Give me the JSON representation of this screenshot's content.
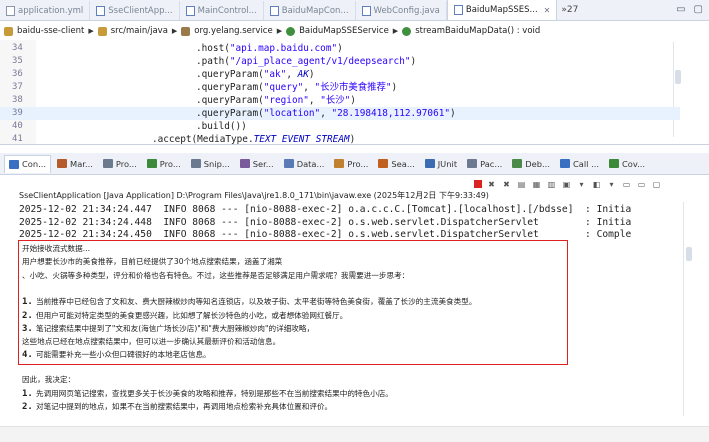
{
  "editor_tabs": [
    {
      "label": "application.yml",
      "active": false
    },
    {
      "label": "SseClientApp...",
      "active": false
    },
    {
      "label": "MainControl...",
      "active": false
    },
    {
      "label": "BaiduMapCon...",
      "active": false
    },
    {
      "label": "WebConfig.java",
      "active": false
    },
    {
      "label": "BaiduMapSSES...",
      "active": true
    }
  ],
  "tab_overflow": "»27",
  "breadcrumb": [
    "baidu-sse-client",
    "src/main/java",
    "org.yelang.service",
    "BaiduMapSSEService",
    "streamBaiduMapData() : void"
  ],
  "code_lines": [
    {
      "num": "34",
      "text": ".host(\"api.map.baidu.com\")"
    },
    {
      "num": "35",
      "text": ".path(\"/api_place_agent/v1/deepsearch\")"
    },
    {
      "num": "36",
      "text": ".queryParam(\"ak\", AK)"
    },
    {
      "num": "37",
      "text": ".queryParam(\"query\", \"长沙市美食推荐\")"
    },
    {
      "num": "38",
      "text": ".queryParam(\"region\", \"长沙\")"
    },
    {
      "num": "39",
      "text": ".queryParam(\"location\", \"28.198418,112.97061\")"
    },
    {
      "num": "40",
      "text": ".build())"
    },
    {
      "num": "41",
      "text": ".accept(MediaType.TEXT_EVENT_STREAM)"
    }
  ],
  "view_tabs": [
    {
      "label": "Con...",
      "active": true,
      "icon": "console-icon",
      "color": "#3a70c2"
    },
    {
      "label": "Mar...",
      "active": false,
      "icon": "markers-icon",
      "color": "#b55a2a"
    },
    {
      "label": "Pro...",
      "active": false,
      "icon": "properties-icon",
      "color": "#6c7a90"
    },
    {
      "label": "Pro...",
      "active": false,
      "icon": "progress-icon",
      "color": "#3a8a3a"
    },
    {
      "label": "Snip...",
      "active": false,
      "icon": "snippets-icon",
      "color": "#6c7a90"
    },
    {
      "label": "Ser...",
      "active": false,
      "icon": "servers-icon",
      "color": "#7a5a9a"
    },
    {
      "label": "Data...",
      "active": false,
      "icon": "data-source-icon",
      "color": "#5a7ab5"
    },
    {
      "label": "Pro...",
      "active": false,
      "icon": "problems-icon",
      "color": "#c08030"
    },
    {
      "label": "Sea...",
      "active": false,
      "icon": "search-icon",
      "color": "#c06020"
    },
    {
      "label": "JUnit",
      "active": false,
      "icon": "junit-icon",
      "color": "#3b6bb0"
    },
    {
      "label": "Pac...",
      "active": false,
      "icon": "package-icon",
      "color": "#6c7a90"
    },
    {
      "label": "Deb...",
      "active": false,
      "icon": "debug-icon",
      "color": "#4a8a4a"
    },
    {
      "label": "Call ...",
      "active": false,
      "icon": "call-hierarchy-icon",
      "color": "#3a70c2"
    },
    {
      "label": "Cov...",
      "active": false,
      "icon": "coverage-icon",
      "color": "#3a8a3a"
    }
  ],
  "console_title": "SseClientApplication [Java Application] D:\\Program Files\\Java\\jre1.8.0_171\\bin\\javaw.exe (2025年12月2日 下午9:33:49)",
  "log_lines": [
    "2025-12-02 21:34:24.447  INFO 8068 --- [nio-8088-exec-2] o.a.c.c.C.[Tomcat].[localhost].[/bdsse]  : Initia",
    "2025-12-02 21:34:24.448  INFO 8068 --- [nio-8088-exec-2] o.s.web.servlet.DispatcherServlet        : Initia",
    "2025-12-02 21:34:24.450  INFO 8068 --- [nio-8088-exec-2] o.s.web.servlet.DispatcherServlet        : Comple"
  ],
  "output_lines": [
    {
      "num": "",
      "text": "开始接收流式数据..."
    },
    {
      "num": "",
      "text": "用户想要长沙市的美食推荐，目前已经提供了30个地点搜索结果，涵盖了湘菜"
    },
    {
      "num": "",
      "text": "、小吃、火锅等多种类型，评分和价格也各有特色。不过，这些推荐是否足够满足用户需求呢？我需要进一步思考："
    },
    {
      "num": "",
      "text": ""
    },
    {
      "num": "1.",
      "text": "当前推荐中已经包含了文和友、费大厨辣椒炒肉等知名连锁店，以及坡子街、太平老街等特色美食街，覆盖了长沙的主流美食类型。"
    },
    {
      "num": "2.",
      "text": "但用户可能对特定类型的美食更感兴趣，比如想了解长沙特色的小吃，或者想体验网红餐厅。"
    },
    {
      "num": "3.",
      "text": "笔记搜索结果中提到了\"文和友(海信广场长沙店)\"和\"费大厨辣椒炒肉\"的详细攻略，"
    },
    {
      "num": "",
      "text": "这些地点已经在地点搜索结果中，但可以进一步确认其最新评价和活动信息。"
    },
    {
      "num": "4.",
      "text": "可能需要补充一些小众但口碑很好的本地老店信息。"
    }
  ],
  "after_lines": [
    {
      "num": "",
      "text": "因此，我决定："
    },
    {
      "num": "1.",
      "text": "先调用网页笔记搜索，查找更多关于长沙美食的攻略和推荐，特别是那些不在当前搜索结果中的特色小店。"
    },
    {
      "num": "2.",
      "text": "对笔记中提到的地点，如果不在当前搜索结果中，再调用地点检索补充具体位置和评价。"
    }
  ],
  "colors": {
    "highlight_border": "#e02020",
    "string": "#2a00ff",
    "keyword": "#7f0055",
    "constant": "#0000c0",
    "line_highlight": "#e8f2fe"
  }
}
